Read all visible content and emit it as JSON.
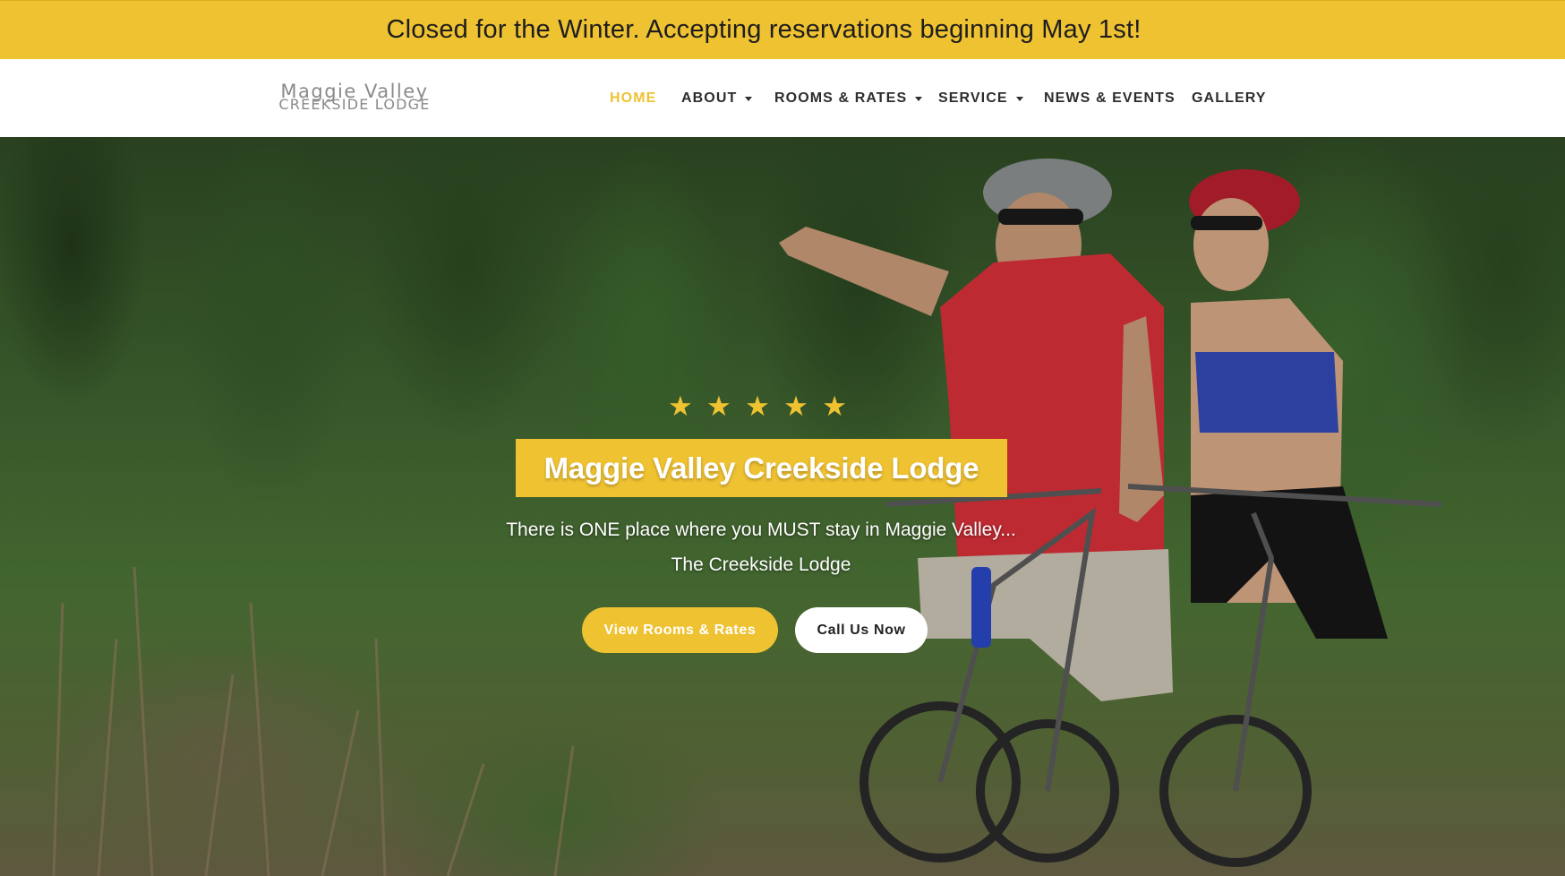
{
  "announcement": "Closed for the Winter. Accepting reservations beginning May 1st!",
  "logo": {
    "line1": "Maggie Valley",
    "line2": "CREEKSIDE LODGE"
  },
  "nav": {
    "items": [
      {
        "label": "HOME",
        "active": true,
        "dropdown": false
      },
      {
        "label": "ABOUT",
        "active": false,
        "dropdown": true
      },
      {
        "label": "ROOMS & RATES",
        "active": false,
        "dropdown": true
      },
      {
        "label": "SERVICE",
        "active": false,
        "dropdown": true
      },
      {
        "label": "NEWS & EVENTS",
        "active": false,
        "dropdown": false
      },
      {
        "label": "GALLERY",
        "active": false,
        "dropdown": false
      }
    ]
  },
  "hero": {
    "rating": {
      "stars": 5,
      "icon": "star-icon"
    },
    "title": "Maggie Valley Creekside Lodge",
    "tagline_line1": "There is ONE place where you MUST stay in Maggie Valley...",
    "tagline_line2": "The Creekside Lodge",
    "primary_button": "View Rooms & Rates",
    "secondary_button": "Call Us Now",
    "image_subject": "couple-on-mountain-bikes-photo"
  },
  "colors": {
    "accent": "#efc232",
    "text_dark": "#2d2d2d",
    "white": "#ffffff"
  }
}
